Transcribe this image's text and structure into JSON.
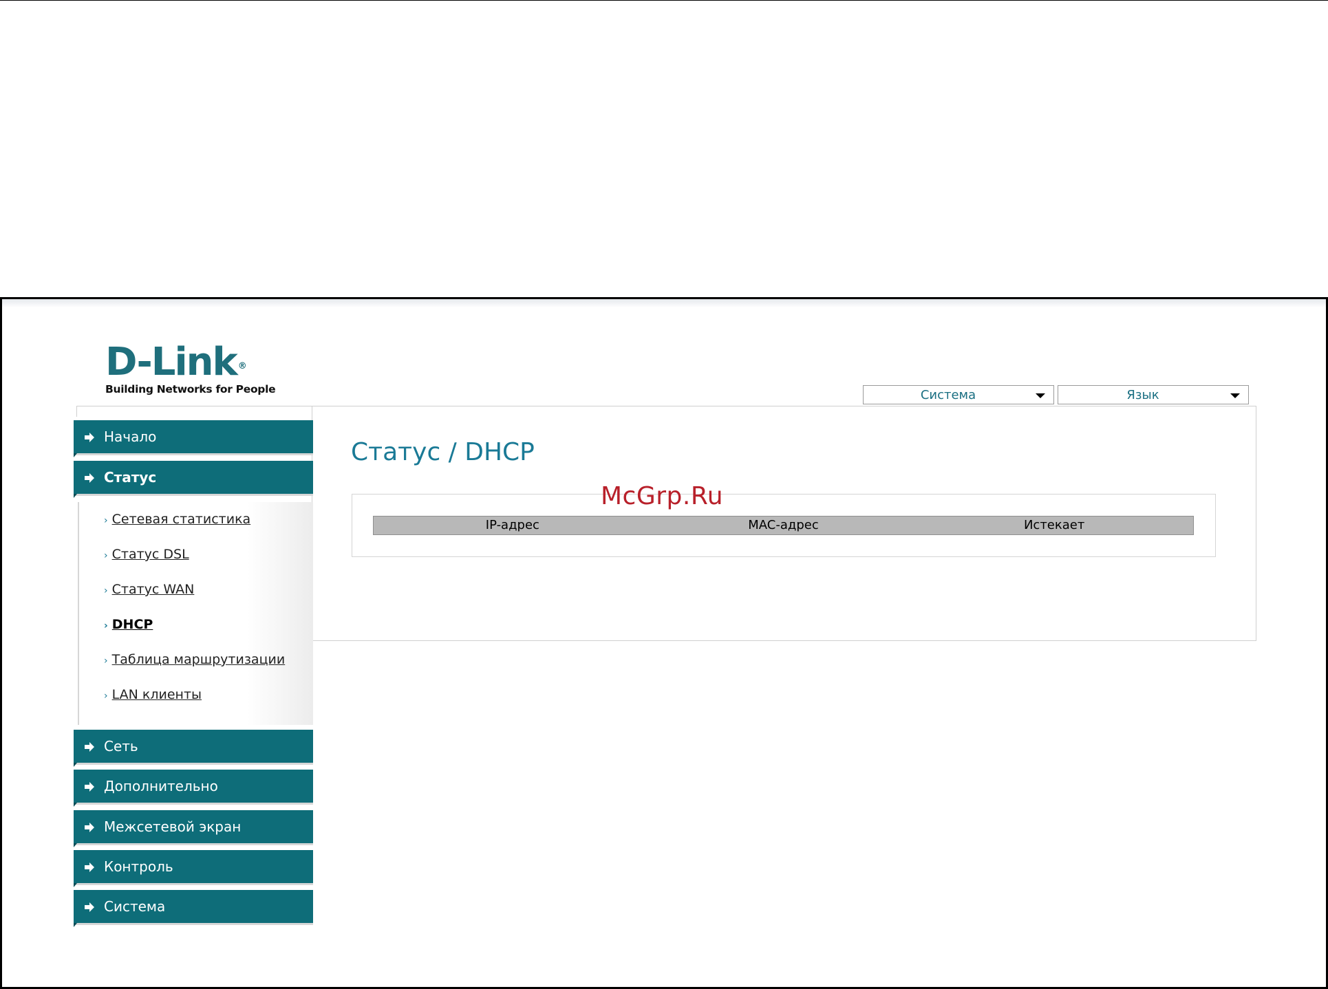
{
  "logo": {
    "brand": "D-Link",
    "registered": "®",
    "tagline": "Building Networks for People"
  },
  "header": {
    "system_select": "Система",
    "language_select": "Язык"
  },
  "main": {
    "title": "Статус / DHCP",
    "table": {
      "columns": [
        "IP-адрес",
        "MAC-адрес",
        "Истекает"
      ],
      "rows": []
    }
  },
  "watermark": "McGrp.Ru",
  "sidebar": {
    "sections": [
      {
        "label": "Начало"
      },
      {
        "label": "Статус"
      },
      {
        "label": "Сеть"
      },
      {
        "label": "Дополнительно"
      },
      {
        "label": "Межсетевой экран"
      },
      {
        "label": "Контроль"
      },
      {
        "label": "Система"
      }
    ],
    "status_items": [
      {
        "label": "Сетевая статистика"
      },
      {
        "label": "Статус DSL"
      },
      {
        "label": "Статус WAN"
      },
      {
        "label": "DHCP"
      },
      {
        "label": "Таблица маршрутизации"
      },
      {
        "label": "LAN клиенты"
      }
    ],
    "bullet": "›"
  },
  "colors": {
    "menu": "#0e6d79",
    "title": "#1a7a96",
    "watermark": "#b8202a"
  }
}
